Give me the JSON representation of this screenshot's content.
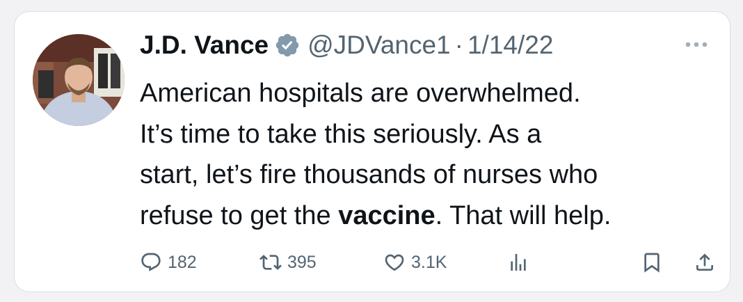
{
  "tweet": {
    "author_name": "J.D. Vance",
    "handle": "@JDVance1",
    "separator": "·",
    "date": "1/14/22",
    "text": {
      "line1": "American hospitals are overwhelmed.",
      "line2": "It’s time to take this seriously.  As a",
      "line3": "start, let’s fire thousands of nurses who",
      "line4_before": "refuse to get the ",
      "line4_bold": "vaccine",
      "line4_after": ". That will help."
    }
  },
  "actions": {
    "replies": "182",
    "reposts": "395",
    "likes": "3.1K"
  },
  "icons": {
    "verified_badge": "verified-badge-icon",
    "more": "more-options-icon",
    "reply": "reply-bubble-icon",
    "repost": "repost-icon",
    "like": "heart-icon",
    "views": "bar-chart-icon",
    "bookmark": "bookmark-icon",
    "share": "share-icon"
  },
  "colors": {
    "text_primary": "#0f1419",
    "text_secondary": "#536471",
    "verified_badge": "#829aab",
    "card_border": "#d9dde1",
    "page_background": "#f2f2f4"
  }
}
